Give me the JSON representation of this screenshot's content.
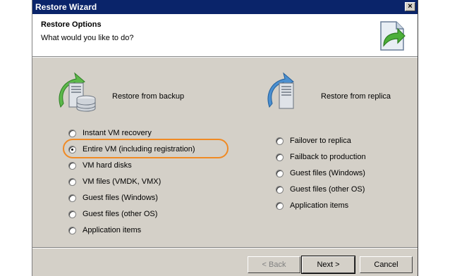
{
  "window": {
    "title": "Restore Wizard",
    "close_glyph": "×"
  },
  "header": {
    "title": "Restore Options",
    "subtitle": "What would you like to do?",
    "icon": "restore-wizard-icon"
  },
  "backup_group": {
    "label": "Restore from backup",
    "icon": "backup-server-database-icon",
    "options": [
      {
        "label": "Instant VM recovery",
        "checked": false
      },
      {
        "label": "Entire VM (including registration)",
        "checked": true
      },
      {
        "label": "VM hard disks",
        "checked": false
      },
      {
        "label": "VM files (VMDK, VMX)",
        "checked": false
      },
      {
        "label": "Guest files (Windows)",
        "checked": false
      },
      {
        "label": "Guest files (other OS)",
        "checked": false
      },
      {
        "label": "Application items",
        "checked": false
      }
    ]
  },
  "replica_group": {
    "label": "Restore from replica",
    "icon": "replica-server-icon",
    "options": [
      {
        "label": "Failover to replica",
        "checked": false
      },
      {
        "label": "Failback to production",
        "checked": false
      },
      {
        "label": "Guest files (Windows)",
        "checked": false
      },
      {
        "label": "Guest files (other OS)",
        "checked": false
      },
      {
        "label": "Application items",
        "checked": false
      }
    ]
  },
  "buttons": {
    "back": "< Back",
    "next": "Next >",
    "cancel": "Cancel"
  },
  "colors": {
    "titlebar": "#0a246a",
    "dialog": "#d4d0c8",
    "highlight": "#f08a24"
  }
}
